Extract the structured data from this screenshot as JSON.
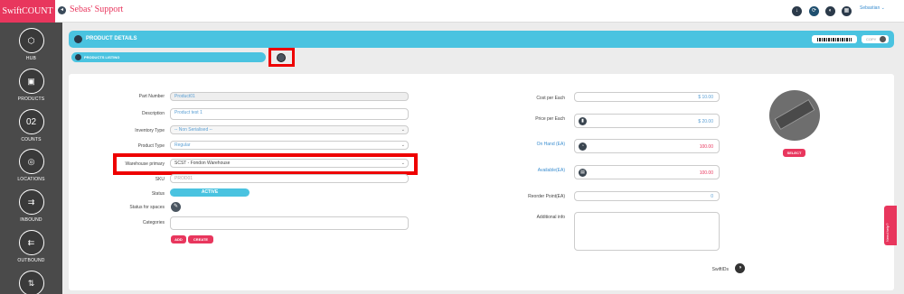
{
  "brand": "SwiftCOUNT",
  "app_title": "Sebas' Support",
  "user_menu": "Sebastian ⌄",
  "sidebar": {
    "items": [
      {
        "label": "HUB",
        "glyph": "⬡"
      },
      {
        "label": "PRODUCTS",
        "glyph": "▣"
      },
      {
        "label": "COUNTS",
        "glyph": "02"
      },
      {
        "label": "LOCATIONS",
        "glyph": "◎"
      },
      {
        "label": "INBOUND",
        "glyph": "⇉"
      },
      {
        "label": "OUTBOUND",
        "glyph": "⇇"
      },
      {
        "label": "",
        "glyph": "⇅"
      }
    ]
  },
  "topbar_icons": [
    "download-icon",
    "sync-icon",
    "notification-icon",
    "calculator-icon"
  ],
  "header": {
    "title": "PRODUCT DETAILS",
    "copy_label": "COPY"
  },
  "breadcrumb": {
    "label": "PRODUCTS LISTING"
  },
  "form": {
    "part_number": {
      "label": "Part Number",
      "value": "Product01"
    },
    "description": {
      "label": "Description",
      "value": "Product test 1"
    },
    "inventory_type": {
      "label": "Inventory Type",
      "value": "-- Non Serialised --"
    },
    "product_type": {
      "label": "Product Type",
      "value": "Regular"
    },
    "warehouse_primary": {
      "label": "Warehouse primary",
      "value": "SCST - Fondon Warehouse"
    },
    "sku": {
      "label": "SKU",
      "value": "PROD01"
    },
    "status": {
      "label": "Status",
      "value": "ACTIVE"
    },
    "status_for_spaces": {
      "label": "Status for spaces"
    },
    "categories": {
      "label": "Categories",
      "value": ""
    },
    "add_label": "ADD",
    "create_label": "CREATE"
  },
  "right": {
    "cost_per_each": {
      "label": "Cost per Each",
      "value": "$ 10.00"
    },
    "price_per_each": {
      "label": "Price per Each",
      "value": "$ 20.00"
    },
    "on_hand": {
      "label": "On Hand (EA)",
      "value": "100.00"
    },
    "available": {
      "label": "Available(EA)",
      "value": "100.00"
    },
    "reorder_point": {
      "label": "Reorder Point(EA)",
      "value": "0"
    },
    "additional_info": {
      "label": "Additional info",
      "value": ""
    },
    "select_label": "SELECT",
    "swift_ids_label": "SwiftIDs"
  },
  "help_tab": "Need help?",
  "colors": {
    "brand": "#e8365d",
    "accent": "#4ac3e0",
    "highlight": "#e00000"
  }
}
